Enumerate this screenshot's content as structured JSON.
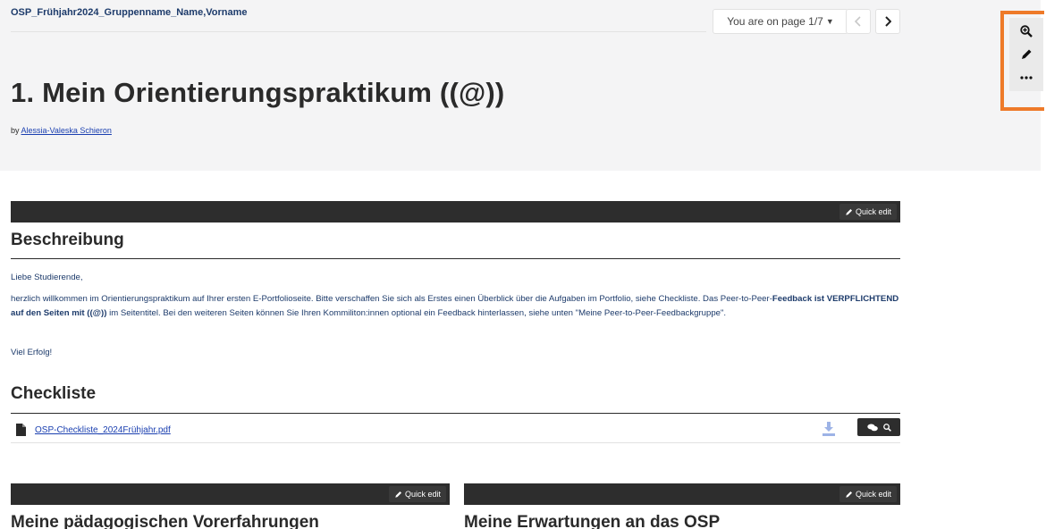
{
  "header": {
    "collection_title": "OSP_Frühjahr2024_Gruppenname_Name,Vorname",
    "page_indicator": "You are on page 1/7",
    "page_title": "1. Mein Orientierungspraktikum ((@))",
    "byline_prefix": "by",
    "author": "Alessia-Valeska Schieron"
  },
  "tools": {
    "icons": [
      "zoom-in-icon",
      "pencil-icon",
      "more-icon"
    ]
  },
  "blocks": {
    "quick_edit_label": "Quick edit",
    "beschreibung": {
      "title": "Beschreibung",
      "greeting": "Liebe Studierende,",
      "text_part1": "herzlich willkommen im Orientierungspraktikum auf Ihrer ersten E-Portfolioseite. Bitte verschaffen Sie sich als Erstes einen Überblick über die Aufgaben im Portfolio, siehe Checkliste. Das Peer-to-Peer-",
      "text_bold": "Feedback ist VERPFLICHTEND auf den Seiten mit ((@))",
      "text_part2": " im Seitentitel. Bei den weiteren Seiten können Sie Ihren Kommiliton:innen optional ein Feedback hinterlassen, siehe unten \"Meine Peer-to-Peer-Feedbackgruppe\".",
      "closing": "Viel Erfolg!"
    },
    "checkliste": {
      "title": "Checkliste",
      "file_name": "OSP-Checkliste_2024Frühjahr.pdf"
    },
    "vorerfahrungen": {
      "title": "Meine pädagogischen Vorerfahrungen"
    },
    "erwartungen": {
      "title": "Meine Erwartungen an das OSP"
    }
  },
  "colors": {
    "accent": "#ee7a29",
    "bar": "#2d2d2d",
    "text": "#1d3b6b",
    "link": "#1a3fb0"
  }
}
